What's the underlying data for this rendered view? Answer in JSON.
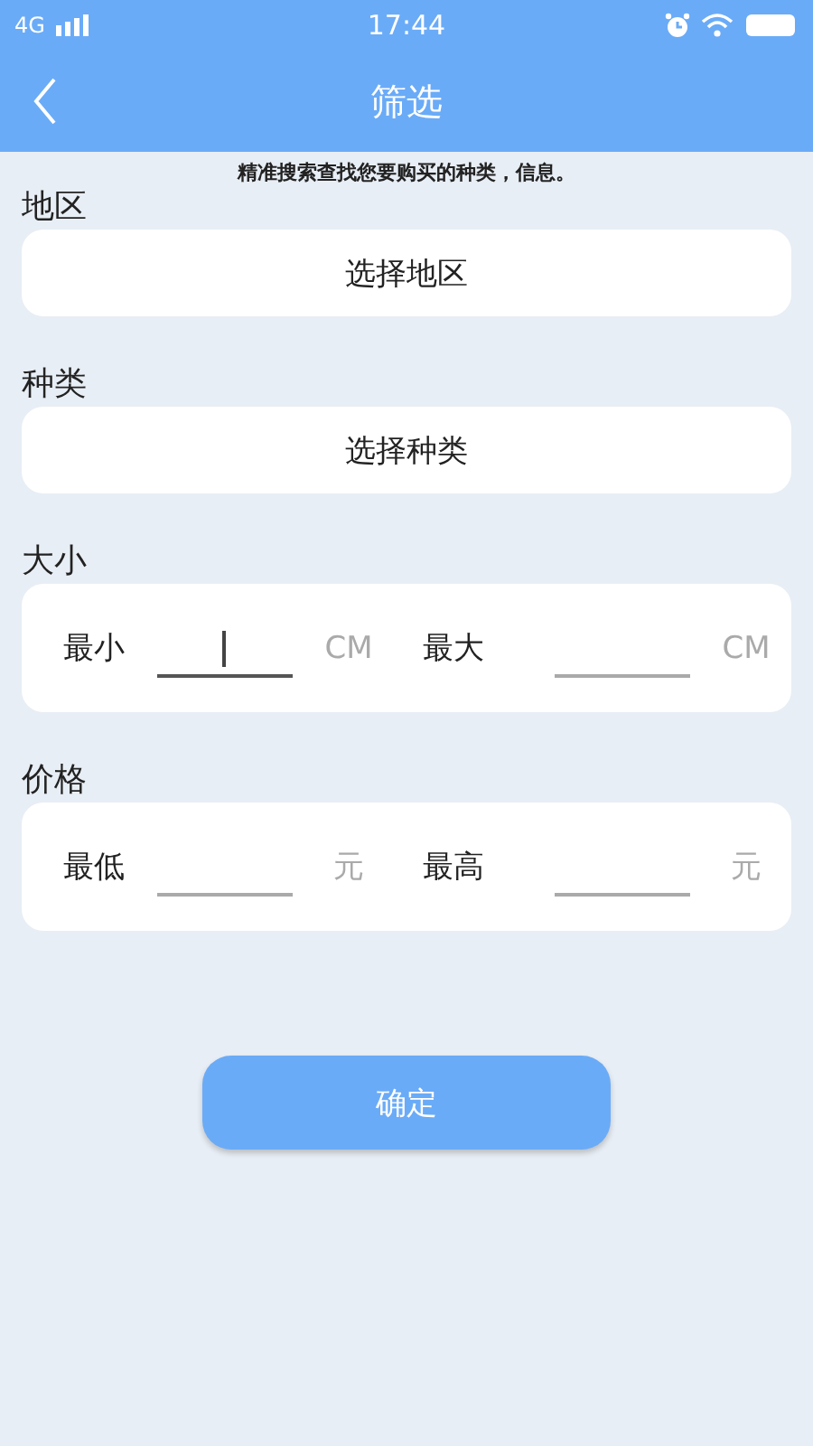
{
  "status_bar": {
    "network": "4G",
    "time": "17:44"
  },
  "header": {
    "title": "筛选"
  },
  "hint": "精准搜索查找您要购买的种类，信息。",
  "sections": [
    {
      "kind": "select",
      "label": "地区",
      "value": "选择地区"
    },
    {
      "kind": "select",
      "label": "种类",
      "value": "选择种类"
    },
    {
      "kind": "range",
      "label": "大小",
      "fields": [
        {
          "label": "最小",
          "unit": "CM",
          "focused": true
        },
        {
          "label": "最大",
          "unit": "CM",
          "focused": false
        }
      ]
    },
    {
      "kind": "range",
      "label": "价格",
      "fields": [
        {
          "label": "最低",
          "unit": "元",
          "focused": false
        },
        {
          "label": "最高",
          "unit": "元",
          "focused": false
        }
      ]
    }
  ],
  "confirm_button": "确定"
}
